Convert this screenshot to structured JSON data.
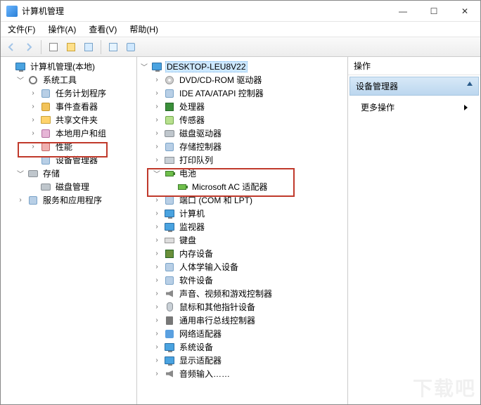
{
  "window": {
    "title": "计算机管理",
    "buttons": {
      "min": "—",
      "max": "☐",
      "close": "✕"
    }
  },
  "menu": {
    "file": "文件(F)",
    "action": "操作(A)",
    "view": "查看(V)",
    "help": "帮助(H)"
  },
  "toolbar": {
    "back": "back-icon",
    "forward": "forward-icon",
    "up": "up-icon",
    "props": "properties-icon",
    "refresh": "refresh-icon",
    "export": "export-icon",
    "help": "help-icon"
  },
  "left": {
    "root": "计算机管理(本地)",
    "systools": "系统工具",
    "systools_children": {
      "scheduler": "任务计划程序",
      "eventviewer": "事件查看器",
      "shared": "共享文件夹",
      "users": "本地用户和组",
      "perf": "性能",
      "devmgr": "设备管理器"
    },
    "storage": "存储",
    "storage_children": {
      "diskmgmt": "磁盘管理"
    },
    "services": "服务和应用程序"
  },
  "mid": {
    "host": "DESKTOP-LEU8V22",
    "items": {
      "dvd": "DVD/CD-ROM 驱动器",
      "ide": "IDE ATA/ATAPI 控制器",
      "cpu": "处理器",
      "sensor": "传感器",
      "disk": "磁盘驱动器",
      "storage": "存储控制器",
      "printq": "打印队列",
      "battery": "电池",
      "battery_child": "Microsoft AC 适配器",
      "ports": "端口 (COM 和 LPT)",
      "computer": "计算机",
      "monitor": "监视器",
      "keyboard": "键盘",
      "memory": "内存设备",
      "hid": "人体学输入设备",
      "software": "软件设备",
      "sound": "声音、视频和游戏控制器",
      "mouse": "鼠标和其他指针设备",
      "usb": "通用串行总线控制器",
      "netadapter": "网络适配器",
      "system": "系统设备",
      "display": "显示适配器",
      "audioio": "音频输入……"
    }
  },
  "right": {
    "header": "操作",
    "band": "设备管理器",
    "more": "更多操作"
  },
  "watermark": "下载吧"
}
